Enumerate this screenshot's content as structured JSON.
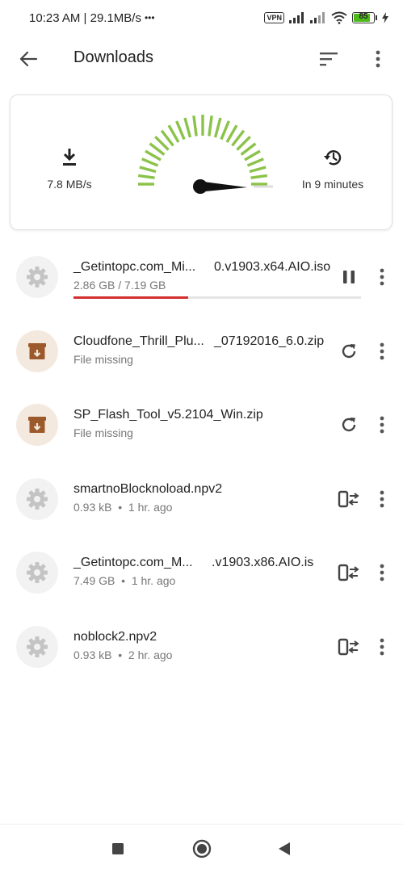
{
  "status_bar": {
    "time_speed": "10:23 AM | 29.1MB/s",
    "dots": "•••",
    "vpn": "VPN",
    "battery_level": "85"
  },
  "app_bar": {
    "title": "Downloads"
  },
  "speed_card": {
    "speed_label": "7.8 MB/s",
    "eta_label": "In 9 minutes",
    "gauge_level": 0.75,
    "gauge_color": "#8bc34a"
  },
  "colors": {
    "accent_progress": "#d32f2f",
    "archive_brown": "#a0522d"
  },
  "downloads": [
    {
      "name_start": "_Getintopc.com_Mi...",
      "name_end": "0.v1903.x64.AIO.iso",
      "meta": "2.86 GB / 7.19 GB",
      "progress": 0.4,
      "icon": "gear-icon",
      "action": "pause-icon"
    },
    {
      "name_start": "Cloudfone_Thrill_Plu...",
      "name_end": "_07192016_6.0.zip",
      "meta": "File missing",
      "icon": "archive-icon",
      "action": "retry-icon"
    },
    {
      "name_start": "SP_Flash_Tool_v5.2104_Win.zip",
      "name_end": "",
      "meta": "File missing",
      "icon": "archive-icon",
      "action": "retry-icon"
    },
    {
      "name_start": "smartnoBlocknoload.npv2",
      "name_end": "",
      "meta": "0.93 kB  •  1 hr. ago",
      "icon": "gear-icon",
      "action": "transfer-icon"
    },
    {
      "name_start": "_Getintopc.com_M...",
      "name_end": ".v1903.x86.AIO.is",
      "meta": "7.49 GB  •  1 hr. ago",
      "icon": "gear-icon",
      "action": "transfer-icon"
    },
    {
      "name_start": "noblock2.npv2",
      "name_end": "",
      "meta": "0.93 kB  •  2 hr. ago",
      "icon": "gear-icon",
      "action": "transfer-icon"
    }
  ]
}
